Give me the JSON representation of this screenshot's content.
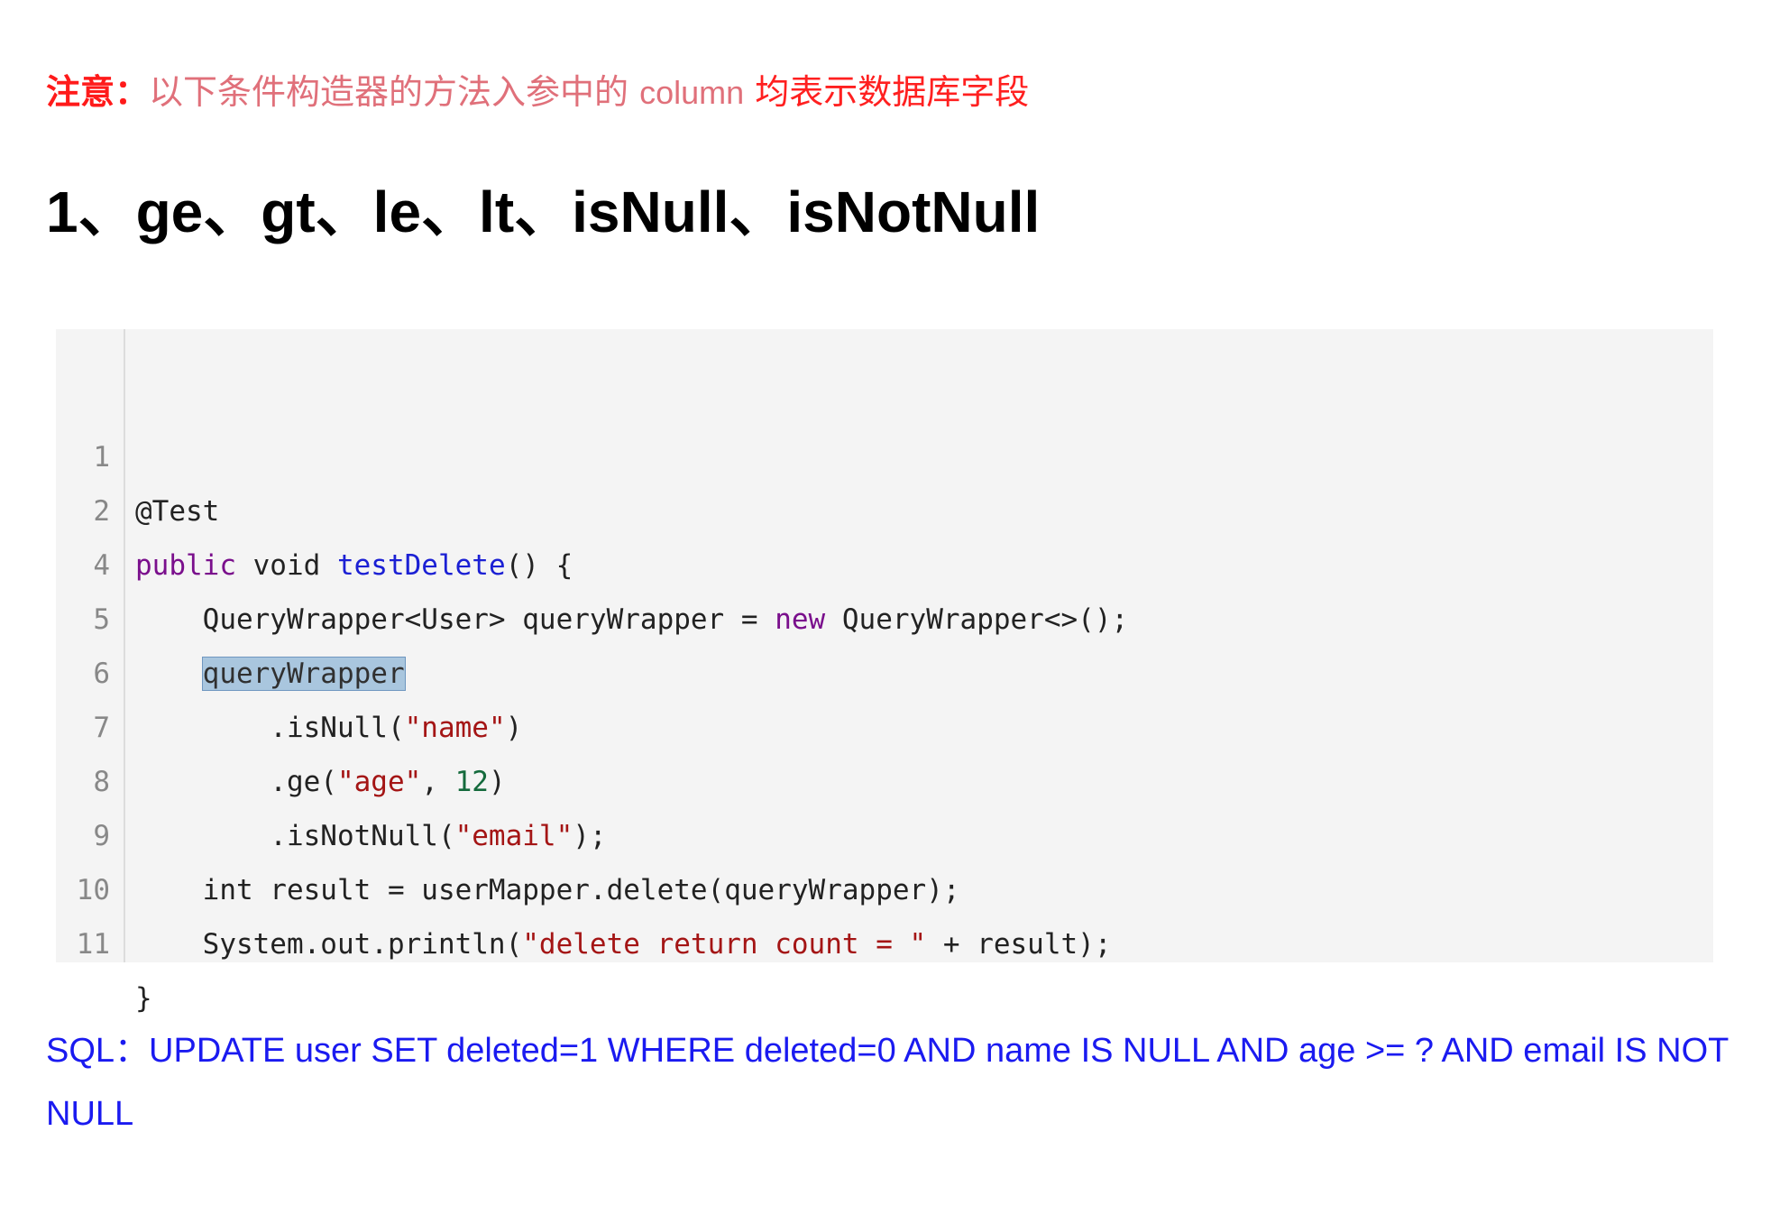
{
  "note": {
    "prefix": "注意：",
    "text_part1": "以下条件构造器的方法入参中的",
    "column_word": "column",
    "text_part2": "均表示数据库字段"
  },
  "heading": "1、ge、gt、le、lt、isNull、isNotNull",
  "code_block": {
    "line_numbers": [
      "1",
      "2",
      "4",
      "5",
      "6",
      "7",
      "8",
      "9",
      "10",
      "11"
    ],
    "l1": "@Test",
    "l2_public": "public",
    "l2_void": " void ",
    "l2_fn": "testDelete",
    "l2_rest": "() {",
    "l3_a": "    QueryWrapper<User> queryWrapper = ",
    "l3_new": "new",
    "l3_b": " QueryWrapper<>();",
    "l4_indent": "    ",
    "l4_hl": "queryWrapper",
    "l5_a": "        .isNull(",
    "l5_s": "\"name\"",
    "l5_b": ")",
    "l6_a": "        .ge(",
    "l6_s": "\"age\"",
    "l6_c": ", ",
    "l6_n": "12",
    "l6_b": ")",
    "l7_a": "        .isNotNull(",
    "l7_s": "\"email\"",
    "l7_b": ");",
    "l8": "    int result = userMapper.delete(queryWrapper);",
    "l9_a": "    System.out.println(",
    "l9_s": "\"delete return count = \"",
    "l9_b": " + result);",
    "l10": "}"
  },
  "sql_text": "SQL：UPDATE user SET deleted=1 WHERE deleted=0 AND name IS NULL AND age >= ? AND email IS NOT NULL"
}
